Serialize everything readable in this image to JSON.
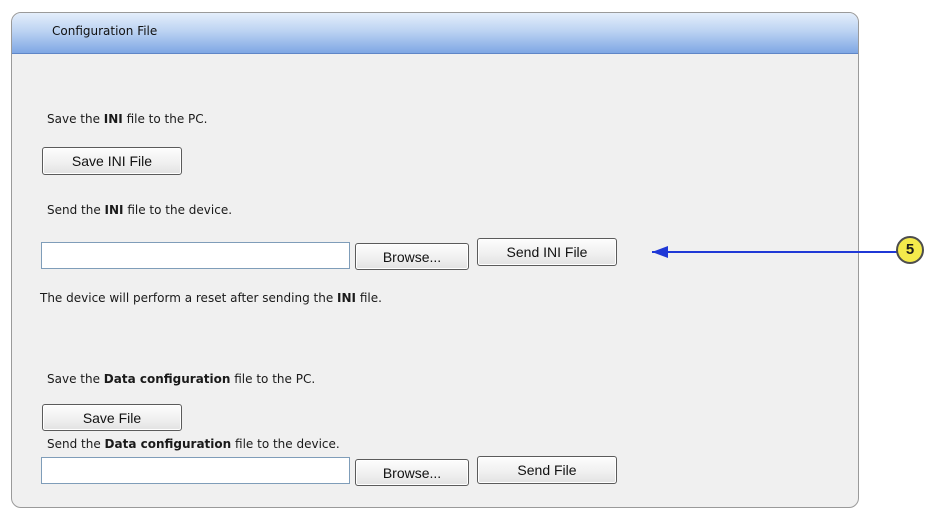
{
  "panel": {
    "title": "Configuration File"
  },
  "ini_section": {
    "save_desc_prefix": "Save the ",
    "save_desc_bold": "INI",
    "save_desc_suffix": " file to the PC.",
    "save_button": "Save INI File",
    "send_desc_prefix": "Send the ",
    "send_desc_bold": "INI",
    "send_desc_suffix": " file to the device.",
    "file_input_value": "",
    "browse_button": "Browse...",
    "send_button": "Send INI File",
    "note_prefix": "The device will perform a reset after sending the ",
    "note_bold": "INI",
    "note_suffix": " file."
  },
  "data_section": {
    "save_desc_prefix": "Save the ",
    "save_desc_bold": "Data configuration",
    "save_desc_suffix": " file to the PC.",
    "save_button": "Save File",
    "send_desc_prefix": "Send the ",
    "send_desc_bold": "Data configuration",
    "send_desc_suffix": " file to the device.",
    "file_input_value": "",
    "browse_button": "Browse...",
    "send_button": "Send File"
  },
  "callout": {
    "number": "5",
    "color": "#1f38d6",
    "badge_color": "#f4ea4b"
  }
}
